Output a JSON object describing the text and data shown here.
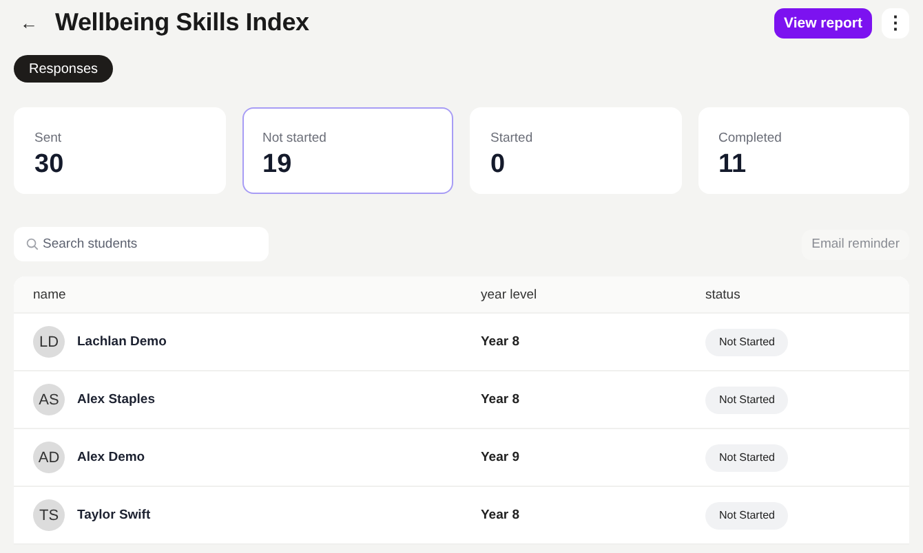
{
  "header": {
    "back_icon": "←",
    "title": "Wellbeing Skills Index",
    "primary_button": "View report",
    "more_icon": "⋮"
  },
  "tabs": [
    {
      "label": "Responses",
      "selected": true
    }
  ],
  "stats": [
    {
      "label": "Sent",
      "value": "30",
      "selected": false
    },
    {
      "label": "Not started",
      "value": "19",
      "selected": true
    },
    {
      "label": "Started",
      "value": "0",
      "selected": false
    },
    {
      "label": "Completed",
      "value": "11",
      "selected": false
    }
  ],
  "search": {
    "placeholder": "Search students"
  },
  "email_button": {
    "label": "Email reminder",
    "disabled": true
  },
  "table": {
    "columns": [
      "name",
      "year level",
      "status"
    ],
    "rows": [
      {
        "initials": "LD",
        "name": "Lachlan Demo",
        "year_level": "Year 8",
        "status": "Not Started"
      },
      {
        "initials": "AS",
        "name": "Alex Staples",
        "year_level": "Year 8",
        "status": "Not Started"
      },
      {
        "initials": "AD",
        "name": "Alex Demo",
        "year_level": "Year 9",
        "status": "Not Started"
      },
      {
        "initials": "TS",
        "name": "Taylor Swift",
        "year_level": "Year 8",
        "status": "Not Started"
      }
    ]
  }
}
